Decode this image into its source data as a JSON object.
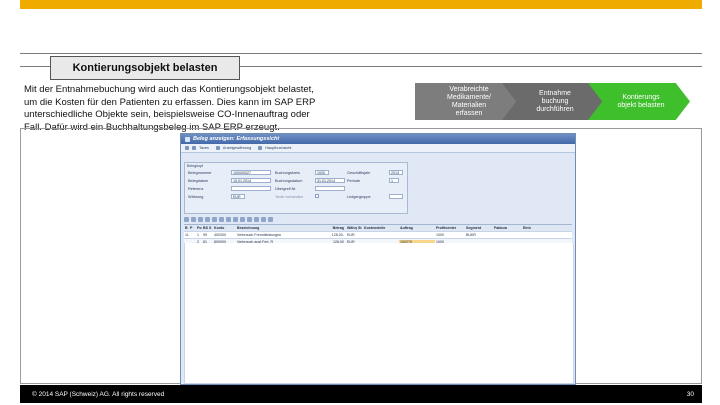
{
  "slide": {
    "title": "Kontierungsobjekt belasten",
    "body": "Mit der Entnahmebuchung wird auch das Kontierungsobjekt belastet, um die Kosten für den Patienten zu erfassen.  Dies kann im SAP ERP unterschiedliche Objekte sein, beispielsweise CO-Innenauftrag oder Fall. Dafür wird ein Buchhaltungsbeleg im SAP ERP erzeugt.",
    "process_steps": [
      {
        "label": "Verabreichte\nMedikamente/\nMaterialien\nerfassen",
        "state": "done"
      },
      {
        "label": "Entnahme\nbuchung\ndurchführen",
        "state": "done"
      },
      {
        "label": "Kontierungs\nobjekt belasten",
        "state": "current"
      }
    ],
    "colors": {
      "accent": "#f0ab00",
      "step_done": "#7d7d7d",
      "step_current": "#3fbf2c"
    }
  },
  "sap": {
    "window_title": "Beleg anzeigen: Erfassungssicht",
    "toolbar": [
      "Taxes",
      "Anzeigewährung",
      "Hauptbuchsicht"
    ],
    "group_title": "Belegkopf",
    "fields": {
      "belegnummer_label": "Belegnummer",
      "belegnummer_value": "100000027",
      "buchungskreis_label": "Buchungskreis",
      "buchungskreis_value": "1000",
      "geschaeftsjahr_label": "Geschäftsjahr",
      "geschaeftsjahr_value": "2013",
      "belegdatum_label": "Belegdatum",
      "belegdatum_value": "15.01.2014",
      "buchungsdatum_label": "Buchungsdatum",
      "buchungsdatum_value": "31.01.2014",
      "periode_label": "Periode",
      "periode_value": "1",
      "referenz_label": "Referenz",
      "referenz_value": "",
      "uebergreifnr_label": "Übergreif.Nr",
      "uebergreifnr_value": "",
      "waehrung_label": "Währung",
      "waehrung_value": "EUR",
      "texte_label": "Texte vorhanden",
      "ledgergruppe_label": "Ledgergruppe"
    },
    "table": {
      "headers": [
        "B",
        "P",
        "Pos",
        "BS",
        "S",
        "Konto",
        "Bezeichnung",
        "Betrag",
        "Währg",
        "St",
        "Kostenstelle",
        "Auftrag",
        "Profitcenter",
        "Segment",
        "Faktura",
        "Einh"
      ],
      "rows": [
        [
          "1L",
          "",
          "1",
          "99",
          "",
          "400300",
          "Verbrauch Fremdleistungen",
          "128,00-",
          "EUR",
          "",
          "",
          "",
          "1000",
          "BUKR",
          "",
          ""
        ],
        [
          "",
          "",
          "2",
          "81",
          "",
          "890000",
          "Verbrauch ausf.Fert. R",
          "128,00",
          "EUR",
          "",
          "",
          "100270",
          "1000",
          "",
          "",
          ""
        ]
      ]
    }
  },
  "footer": {
    "copyright": "© 2014 SAP (Schweiz) AG. All rights reserved",
    "page_number": "30"
  }
}
